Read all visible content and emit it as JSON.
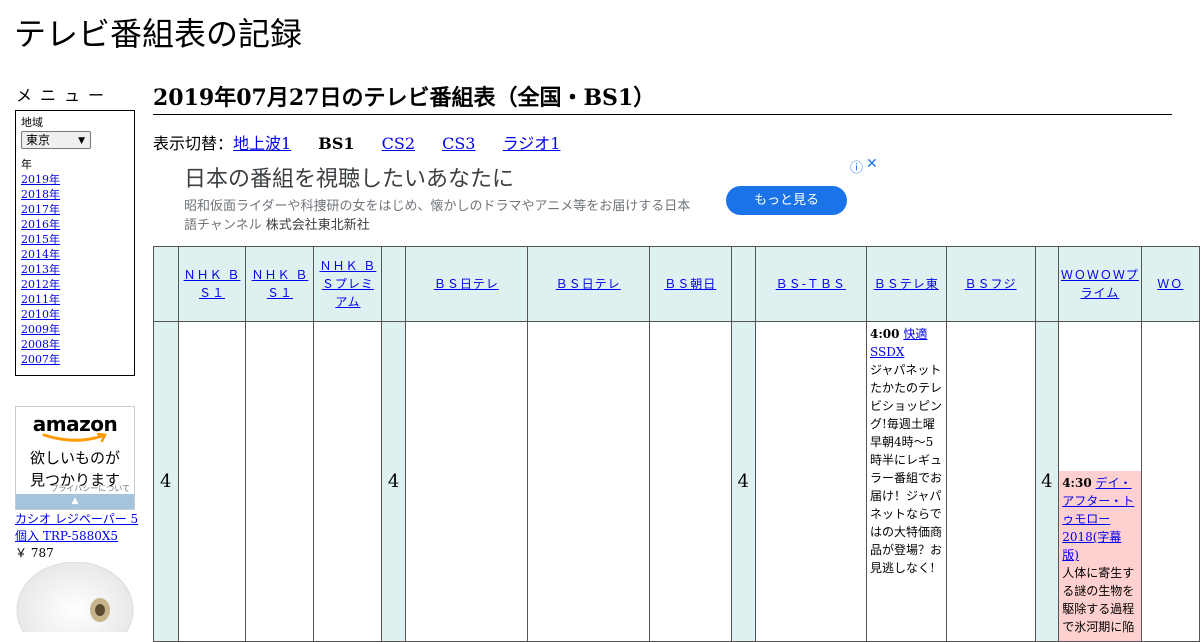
{
  "site_title": "テレビ番組表の記録",
  "sidebar": {
    "menu_title": "メニュー",
    "region_label": "地域",
    "region_value": "東京",
    "year_label": "年",
    "years": [
      "2019年",
      "2018年",
      "2017年",
      "2016年",
      "2015年",
      "2014年",
      "2013年",
      "2012年",
      "2011年",
      "2010年",
      "2009年",
      "2008年",
      "2007年"
    ]
  },
  "amazon_ad": {
    "logo": "amazon",
    "tagline_1": "欲しいものが",
    "tagline_2": "見つかります",
    "privacy": "プライバシーについて",
    "product_name": "カシオ レジペーパー 5個入 TRP-5880X5",
    "product_price": "￥ 787"
  },
  "main": {
    "heading": "2019年07月27日のテレビ番組表（全国・BS1）",
    "switch_label": "表示切替：",
    "switches": {
      "s1": "地上波1",
      "s2": "BS1",
      "s3": "CS2",
      "s4": "CS3",
      "s5": "ラジオ1"
    }
  },
  "top_ad": {
    "title": "日本の番組を視聴したいあなたに",
    "desc": "昭和仮面ライダーや科捜研の女をはじめ、懐かしのドラマやアニメ等をお届けする日本語チャンネル",
    "advertiser": "株式会社東北新社",
    "button": "もっと見る",
    "info_icon": "ⓘ",
    "close_icon": "✕"
  },
  "table": {
    "channels": {
      "c1": "ＮＨＫ ＢＳ１",
      "c2": "ＮＨＫ ＢＳ１",
      "c3": "ＮＨＫ ＢＳプレミアム",
      "c5": "ＢＳ日テレ",
      "c6": "ＢＳ日テレ",
      "c7": "ＢＳ朝日",
      "c9": "ＢＳ-ＴＢＳ",
      "c10": "ＢＳテレ東",
      "c11": "ＢＳフジ",
      "c13": "ＷＯＷＯＷプライム",
      "c14": "ＷＯ"
    },
    "hour": "4",
    "programs": {
      "bs_tvtokyo": {
        "time": "4:00",
        "title": "快適SSDX",
        "desc": "ジャパネットたかたのテレビショッピング!毎週土曜早朝4時～5時半にレギュラー番組でお届け！ジャパネットならではの大特価商品が登場？お見逃しなく!"
      },
      "wowow": {
        "time": "4:30",
        "title": "デイ・アフター・トゥモロー2018(字幕版)",
        "desc": "人体に寄生する謎の生物を駆除する過程で氷河期に陥っ"
      }
    }
  },
  "colors": {
    "header_bg": "#def0f0",
    "program_pink": "#ffd0d0",
    "link": "#0000ee",
    "ad_button": "#1a73e8"
  }
}
